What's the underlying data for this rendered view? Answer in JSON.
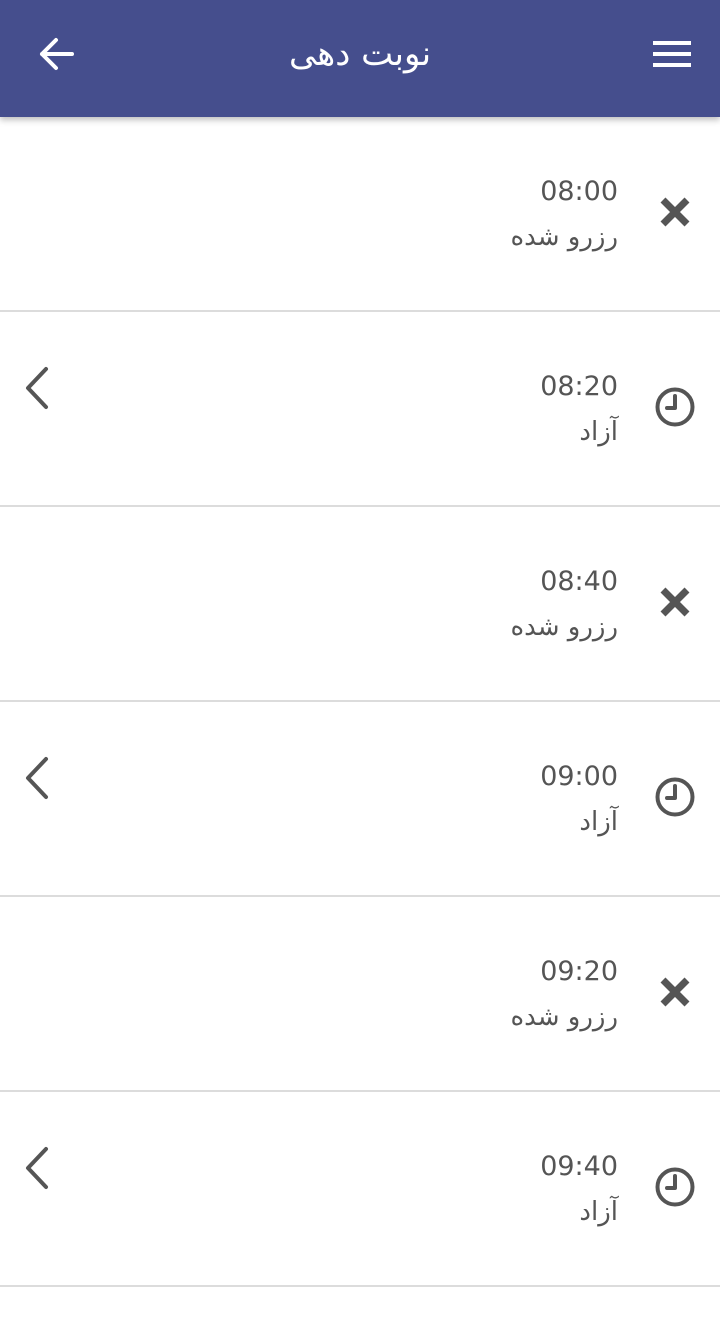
{
  "appbar": {
    "title": "نوبت دهی",
    "back_icon": "arrow-left-icon",
    "menu_icon": "hamburger-menu-icon",
    "background": "#454e8d"
  },
  "slots": [
    {
      "time": "08:00",
      "status": "رزرو شده",
      "icon": "close-icon",
      "available": false
    },
    {
      "time": "08:20",
      "status": "آزاد",
      "icon": "clock-icon",
      "available": true
    },
    {
      "time": "08:40",
      "status": "رزرو شده",
      "icon": "close-icon",
      "available": false
    },
    {
      "time": "09:00",
      "status": "آزاد",
      "icon": "clock-icon",
      "available": true
    },
    {
      "time": "09:20",
      "status": "رزرو شده",
      "icon": "close-icon",
      "available": false
    },
    {
      "time": "09:40",
      "status": "آزاد",
      "icon": "clock-icon",
      "available": true
    }
  ]
}
